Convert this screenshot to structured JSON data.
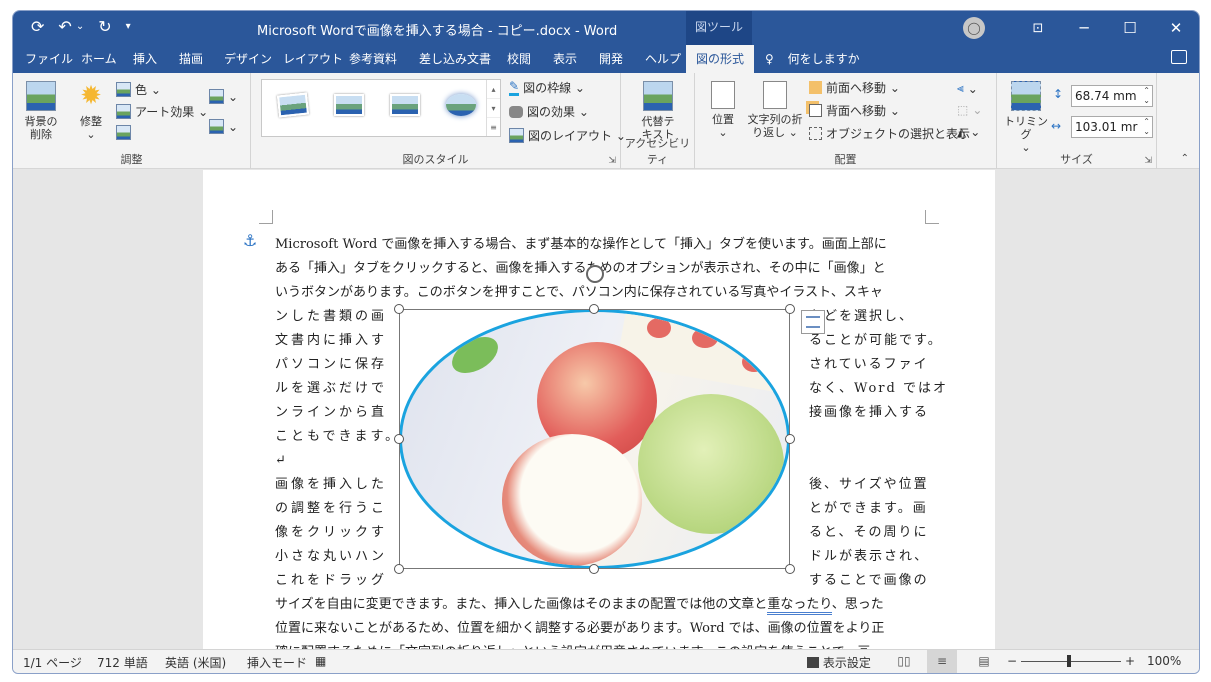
{
  "titlebar": {
    "title": "Microsoft Wordで画像を挿入する場合 - コピー.docx  -  Word",
    "tool_tab": "図ツール",
    "qat": {
      "save": "⟲",
      "undo": "↶",
      "redo": "↻",
      "customize": "▾"
    },
    "controls": {
      "user": "👤",
      "ribbon_options": "▣",
      "minimize": "─",
      "maximize": "☐",
      "close": "✕"
    }
  },
  "tabs": [
    {
      "label": "ファイル"
    },
    {
      "label": "ホーム"
    },
    {
      "label": "挿入"
    },
    {
      "label": "描画"
    },
    {
      "label": "デザイン"
    },
    {
      "label": "レイアウト"
    },
    {
      "label": "参考資料"
    },
    {
      "label": "差し込み文書"
    },
    {
      "label": "校閲"
    },
    {
      "label": "表示"
    },
    {
      "label": "開発"
    },
    {
      "label": "ヘルプ"
    },
    {
      "label": "図の形式",
      "active": true
    }
  ],
  "tell_me": "何をしますか",
  "ribbon": {
    "adjust": {
      "label": "調整",
      "remove_bg": "背景の\n削除",
      "corrections": "修整",
      "color": "色 ⌄",
      "artistic": "アート効果 ⌄",
      "compress": "",
      "change": "⌄",
      "reset": "⌄"
    },
    "styles": {
      "label": "図のスタイル",
      "border": "図の枠線 ⌄",
      "effects": "図の効果 ⌄",
      "layout": "図のレイアウト ⌄"
    },
    "accessibility": {
      "label": "アクセシビリティ",
      "alt_text": "代替テ\nキスト"
    },
    "arrange": {
      "label": "配置",
      "position": "位置\n⌄",
      "wrap": "文字列の折\nり返し ⌄",
      "forward": "前面へ移動  ⌄",
      "backward": "背面へ移動  ⌄",
      "selection_pane": "オブジェクトの選択と表示"
    },
    "size": {
      "label": "サイズ",
      "crop": "トリミング\n⌄",
      "height": "68.74 mm",
      "width": "103.01 mr"
    }
  },
  "document": {
    "lines_full": [
      "Microsoft Word で画像を挿入する場合、まず基本的な操作として「挿入」タブを使います。画面上部に",
      "ある「挿入」タブをクリックすると、画像を挿入するためのオプションが表示され、その中に「画像」と",
      "いうボタンがあります。このボタンを押すことで、パソコン内に保存されている写真やイラスト、スキャ"
    ],
    "lines_left": [
      "ンした書類の画",
      "文書内に挿入す",
      "パソコンに保存",
      "ルを選ぶだけで",
      "ンラインから直",
      "こともできます。↵",
      "↵",
      "画像を挿入した",
      "の調整を行うこ",
      "像をクリックす",
      "小さな丸いハン",
      "これをドラッグ"
    ],
    "lines_right": [
      "などを選択し、",
      "ることが可能です。",
      "されているファイ",
      "なく、Word ではオ",
      "接画像を挿入する",
      "",
      "",
      "後、サイズや位置",
      "とができます。画",
      "ると、その周りに",
      "ドルが表示され、",
      "することで画像の"
    ],
    "lines_bottom_a": "サイズを自由に変更できます。また、挿入した画像はそのままの配置では他の文章と",
    "lines_bottom_err": "重なったり",
    "lines_bottom_b": "、思った",
    "lines_bottom_2": "位置に来ないことがあるため、位置を細かく調整する必要があります。Word では、画像の位置をより正",
    "lines_bottom_3": "確に配置するために「文字列の折り返し」という設定が用意されています。この設定を使うことで、画"
  },
  "statusbar": {
    "page": "1/1 ページ",
    "words": "712 単語",
    "language": "英語 (米国)",
    "mode": "挿入モード",
    "display_settings": "表示設定",
    "zoom_minus": "−",
    "zoom_plus": "+",
    "zoom": "100%"
  },
  "colors": {
    "titlebar": "#2b579a",
    "tooltab": "#1e4686",
    "picture_border": "#1aa3df"
  }
}
